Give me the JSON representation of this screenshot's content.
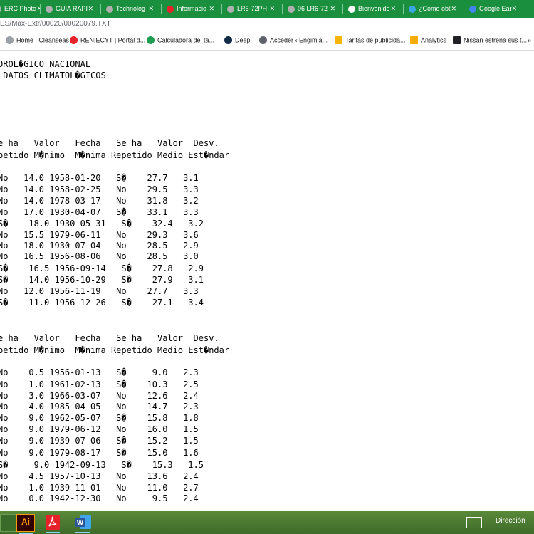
{
  "tabs": [
    {
      "label": "ERC Photo",
      "fav_color": "#b0b0b0"
    },
    {
      "label": "GUIA RAPI",
      "fav_color": "#b0b0b0"
    },
    {
      "label": "Technolog",
      "fav_color": "#b0b0b0"
    },
    {
      "label": "Informacio",
      "fav_color": "#e8222a"
    },
    {
      "label": "LR6-72PH",
      "fav_color": "#b0b0b0"
    },
    {
      "label": "06 LR6-72",
      "fav_color": "#b0b0b0"
    },
    {
      "label": "Bienvenido",
      "fav_color": "#ffffff"
    },
    {
      "label": "¿Cómo obt",
      "fav_color": "#38a6e8"
    },
    {
      "label": "Google Ear",
      "fav_color": "#4285f4"
    }
  ],
  "address": {
    "url": "ES/Max-Extr/00020/00020079.TXT"
  },
  "bookmarks": [
    {
      "label": "Home | Cleanseas",
      "icon": "globe-icon",
      "color": "#9aa0a6"
    },
    {
      "label": "RENIECYT | Portal d...",
      "icon": "reniecyt-icon",
      "color": "#e8222a"
    },
    {
      "label": "Calculadora del ta...",
      "icon": "calculator-icon",
      "color": "#1e9e52"
    },
    {
      "label": "Deepl",
      "icon": "deepl-icon",
      "color": "#0f2b46"
    },
    {
      "label": "Acceder ‹ Engimia...",
      "icon": "wordpress-icon",
      "color": "#5f6368"
    },
    {
      "label": "Tarifas de publicida...",
      "icon": "bulb-icon",
      "color": "#f4b400"
    },
    {
      "label": "Analytics",
      "icon": "analytics-icon",
      "color": "#f9ab00"
    },
    {
      "label": "Nissan estrena sus t...",
      "icon": "nissan-icon",
      "color": "#202124"
    },
    {
      "label": "»",
      "icon": "more-icon",
      "color": "#202124"
    }
  ],
  "document": {
    "header_lines": [
      "OROL�GICO NACIONAL",
      " DATOS CLIMATOL�GICOS"
    ],
    "section1": {
      "header1": "e ha   Valor   Fecha   Se ha   Valor  Desv.",
      "header2": "petido M�nimo  M�nima Repetido Medio Est�ndar",
      "rows": [
        "No   14.0 1958-01-20   S�    27.7   3.1",
        "No   14.0 1958-02-25   No    29.5   3.3",
        "No   14.0 1978-03-17   No    31.8   3.2",
        "No   17.0 1930-04-07   S�    33.1   3.3",
        "S�    18.0 1930-05-31   S�    32.4   3.2",
        "No   15.5 1979-06-11   No    29.3   3.6",
        "No   18.0 1930-07-04   No    28.5   2.9",
        "No   16.5 1956-08-06   No    28.5   3.0",
        "S�    16.5 1956-09-14   S�    27.8   2.9",
        "S�    14.0 1956-10-29   S�    27.9   3.1",
        "No   12.0 1956-11-19   No    27.7   3.3",
        "S�    11.0 1956-12-26   S�    27.1   3.4"
      ]
    },
    "section2": {
      "header1": "e ha   Valor   Fecha   Se ha   Valor  Desv.",
      "header2": "petido M�nimo  M�nima Repetido Medio Est�ndar",
      "rows": [
        "No    0.5 1956-01-13   S�     9.0   2.3",
        "No    1.0 1961-02-13   S�    10.3   2.5",
        "No    3.0 1966-03-07   No    12.6   2.4",
        "No    4.0 1985-04-05   No    14.7   2.3",
        "No    9.0 1962-05-07   S�    15.8   1.8",
        "No    9.0 1979-06-12   No    16.0   1.5",
        "No    9.0 1939-07-06   S�    15.2   1.5",
        "No    9.0 1979-08-17   S�    15.0   1.6",
        "S�     9.0 1942-09-13   S�    15.3   1.5",
        "No    4.5 1957-10-13   No    13.6   2.4",
        "No    1.0 1939-11-01   No    11.0   2.7",
        "No    0.0 1942-12-30   No     9.5   2.4"
      ]
    }
  },
  "taskbar": {
    "apps": [
      {
        "name": "blank-app-icon",
        "label": "",
        "color": "#3a6b2a"
      },
      {
        "name": "illustrator-icon",
        "label": "Ai",
        "color": "#330000"
      },
      {
        "name": "acrobat-icon",
        "label": "",
        "color": "#e8222a"
      },
      {
        "name": "word-icon",
        "label": "W",
        "color": "#2b579a"
      }
    ],
    "search_label": "Dirección"
  }
}
